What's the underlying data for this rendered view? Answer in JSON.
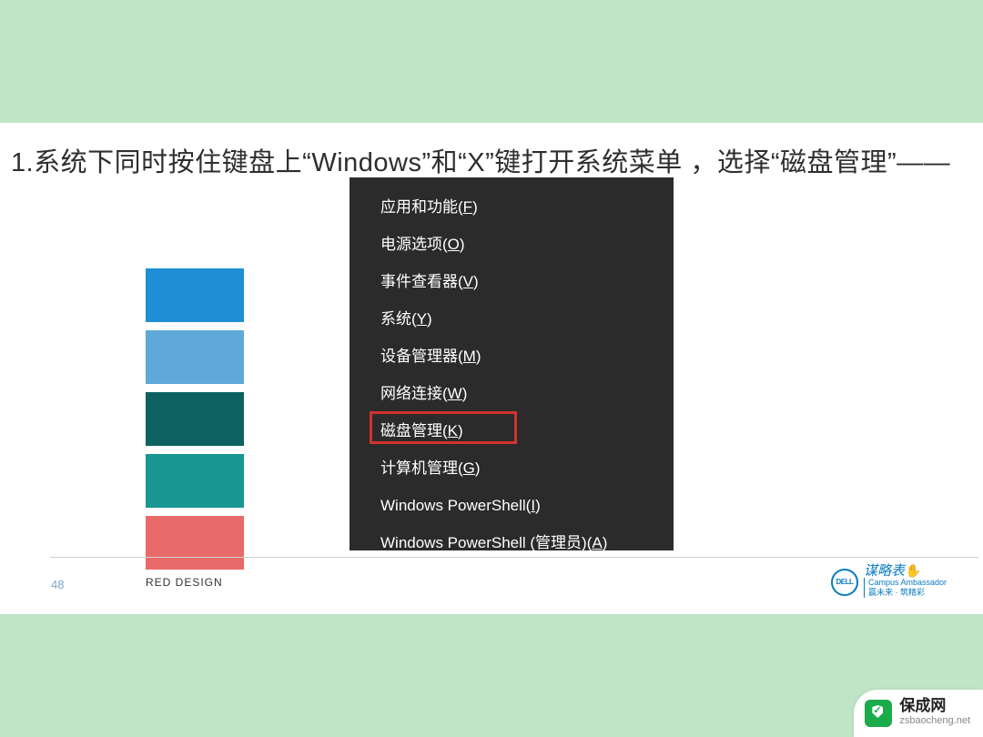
{
  "instruction": "1.系统下同时按住键盘上“Windows”和“X”键打开系统菜单 ，选择“磁盘管理”——",
  "menu": {
    "items": [
      {
        "label": "应用和功能",
        "key": "F"
      },
      {
        "label": "电源选项",
        "key": "O"
      },
      {
        "label": "事件查看器",
        "key": "V"
      },
      {
        "label": "系统",
        "key": "Y"
      },
      {
        "label": "设备管理器",
        "key": "M"
      },
      {
        "label": "网络连接",
        "key": "W"
      },
      {
        "label": "磁盘管理",
        "key": "K"
      },
      {
        "label": "计算机管理",
        "key": "G"
      },
      {
        "label": "Windows PowerShell",
        "key": "I"
      },
      {
        "label": "Windows PowerShell (管理员)",
        "key": "A"
      }
    ],
    "highlighted_index": 6
  },
  "swatches": [
    "#1e8fd6",
    "#5fa9d9",
    "#0e6161",
    "#189691",
    "#e96a6a"
  ],
  "footer": {
    "page": "48",
    "design_label": "RED DESIGN",
    "dell_logo": "DELL",
    "brand": "谋略表",
    "brand_sub1": "Campus Ambassador",
    "brand_sub2": "赢未来 · 筑精彩"
  },
  "watermark": {
    "title": "保成网",
    "url": "zsbaocheng.net"
  }
}
